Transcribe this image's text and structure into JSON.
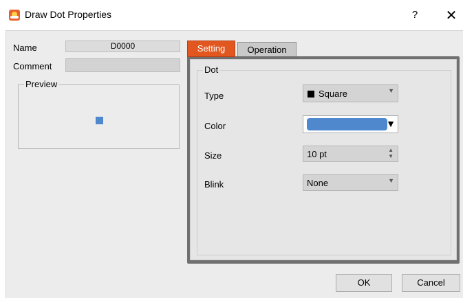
{
  "window": {
    "title": "Draw Dot Properties",
    "help_label": "?",
    "close_label": "✕"
  },
  "left": {
    "name_label": "Name",
    "name_value": "D0000",
    "comment_label": "Comment",
    "comment_value": "",
    "preview_label": "Preview",
    "preview_dot_color": "#4f88cd"
  },
  "tabs": [
    {
      "label": "Setting",
      "active": true
    },
    {
      "label": "Operation",
      "active": false
    }
  ],
  "dot": {
    "group_label": "Dot",
    "type_label": "Type",
    "type_value": "Square",
    "color_label": "Color",
    "color_value": "#4f88cd",
    "size_label": "Size",
    "size_value": "10 pt",
    "blink_label": "Blink",
    "blink_value": "None"
  },
  "buttons": {
    "ok": "OK",
    "cancel": "Cancel"
  },
  "colors": {
    "accent_tab": "#e2561f",
    "dot_blue": "#4f88cd"
  }
}
